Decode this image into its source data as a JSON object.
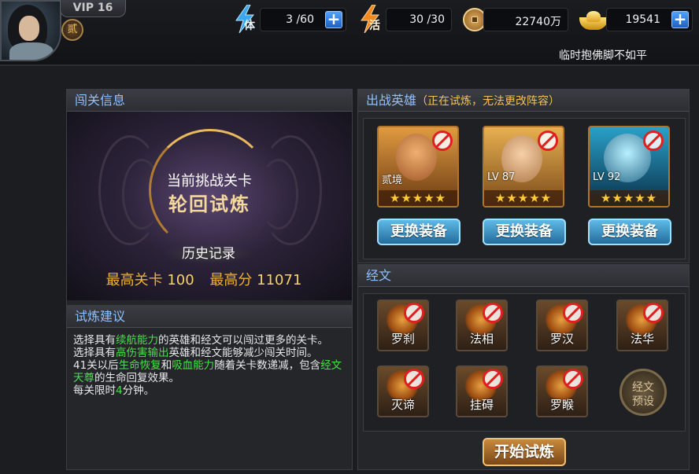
{
  "player": {
    "vip": "VIP 16",
    "rank": "贰"
  },
  "resources": {
    "stamina": {
      "icon_text": "体",
      "value": "3 /60"
    },
    "vigor": {
      "icon_text": "活",
      "value": "30 /30"
    },
    "coins": {
      "value": "22740万"
    },
    "gold": {
      "value": "19541"
    }
  },
  "motto": "临时抱佛脚不如平",
  "challenge_panel": {
    "title": "闯关信息",
    "current_label": "当前挑战关卡",
    "current_name": "轮回试炼",
    "history_label": "历史记录",
    "best_stage_label": "最高关卡",
    "best_stage_value": "100",
    "best_score_label": "最高分",
    "best_score_value": "11071"
  },
  "tips_panel": {
    "title": "试炼建议",
    "lines": [
      [
        "选择具有",
        "续航能力",
        "的英雄和经文可以闯过更多的关卡。"
      ],
      [
        "选择具有",
        "高伤害输出",
        "英雄和经文能够减少闯关时间。"
      ],
      [
        "41关以后",
        "生命恢复",
        "和",
        "吸血能力",
        "随着关卡数递减，包含",
        "经文天尊",
        "的生命回复效果。"
      ],
      [
        "每关限时",
        "4",
        "分钟。"
      ]
    ]
  },
  "heroes_panel": {
    "title": "出战英雄",
    "subtitle": "（正在试炼，无法更改阵容）",
    "heroes": [
      {
        "level": "贰境",
        "stars": "★★★★★",
        "button": "更换装备"
      },
      {
        "level": "LV 87",
        "stars": "★★★★★",
        "button": "更换装备"
      },
      {
        "level": "LV 92",
        "stars": "★★★★★",
        "button": "更换装备"
      }
    ]
  },
  "scripture_panel": {
    "title": "经文",
    "items": [
      "罗刹",
      "法相",
      "罗汉",
      "法华",
      "灭谛",
      "挂碍",
      "罗睺"
    ],
    "preset_button": "经文预设",
    "start_button": "开始试炼"
  },
  "colors": {
    "highlight_green": "#48e04a",
    "title_blue": "#8fc0ff",
    "gold": "#f0b030"
  }
}
